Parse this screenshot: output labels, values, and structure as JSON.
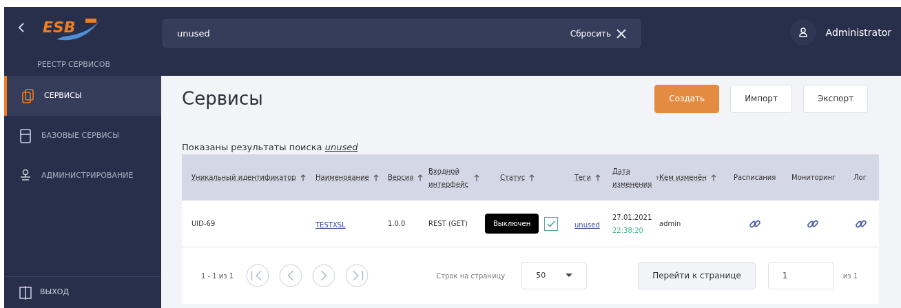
{
  "sidebar": {
    "logo_text": "ESB",
    "subtitle": "РЕЕСТР СЕРВИСОВ",
    "items": [
      {
        "label": "СЕРВИСЫ",
        "selected": true
      },
      {
        "label": "БАЗОВЫЕ СЕРВИСЫ",
        "selected": false
      },
      {
        "label": "АДМИНИСТРИРОВАНИЕ",
        "selected": false
      }
    ],
    "logout": {
      "label": "ВЫХОД"
    }
  },
  "header": {
    "search": {
      "value": "unused",
      "reset_label": "Сбросить"
    },
    "user": "Administrator"
  },
  "page": {
    "title": "Сервисы",
    "buttons": [
      {
        "label": "Создать",
        "kind": "primary"
      },
      {
        "label": "Импорт",
        "kind": "outline"
      },
      {
        "label": "Экспорт",
        "kind": "outline"
      }
    ],
    "search_note": "Показаны результаты поиска *unused*"
  },
  "table": {
    "columns": [
      {
        "label": "Уникальный идентификатор",
        "sortable": true
      },
      {
        "label": "Наименование",
        "sortable": true
      },
      {
        "label": "Версия",
        "sortable": true
      },
      {
        "label": "Входной интерфейс",
        "sortable": true
      },
      {
        "label": "Статус",
        "sortable": true
      },
      {
        "label": "Теги",
        "sortable": true
      },
      {
        "label": "Дата изменения",
        "sortable": true
      },
      {
        "label": "Кем изменён",
        "sortable": true
      },
      {
        "label": "Расписания",
        "sortable": false
      },
      {
        "label": "Мониторинг",
        "sortable": false
      },
      {
        "label": "Лог",
        "sortable": false
      }
    ],
    "rows": [
      {
        "id": "UID-69",
        "name": "TESTXSL",
        "version": "1.0.0",
        "interface": "REST (GET)",
        "status": "Выключен",
        "checked": true,
        "tag": "unused",
        "date": "27.01.2021",
        "time": "22:38:20",
        "by": "admin"
      }
    ]
  },
  "pagination": {
    "range": "1 - 1 из 1",
    "rows_label": "Строк на страницу",
    "rows_value": "50",
    "goto_label": "Перейти к странице",
    "page_value": "1",
    "of": "из 1"
  }
}
